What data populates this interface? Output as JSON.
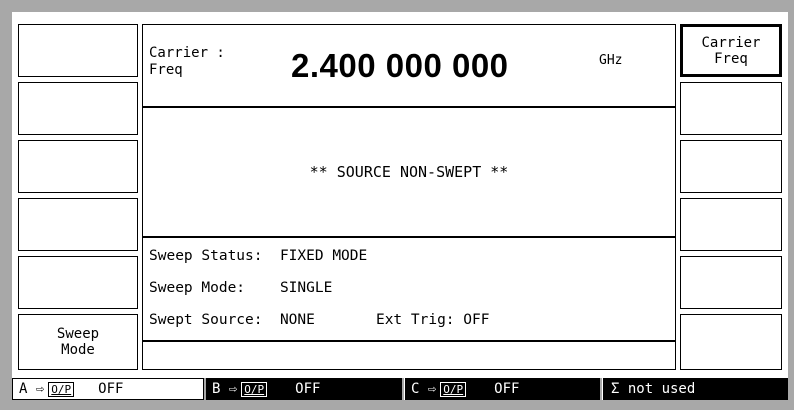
{
  "left_softkeys": [
    "",
    "",
    "",
    "",
    "",
    "Sweep\nMode"
  ],
  "right_softkeys": [
    "Carrier\nFreq",
    "",
    "",
    "",
    "",
    ""
  ],
  "header": {
    "label": "Carrier :\nFreq",
    "value": "2.400 000 000",
    "unit": "GHz"
  },
  "message": "** SOURCE NON-SWEPT **",
  "status": {
    "line1": "Sweep Status:  FIXED MODE",
    "line2": "Sweep Mode:    SINGLE",
    "line3": "Swept Source:  NONE       Ext Trig: OFF"
  },
  "bottom_bar": {
    "a_label": "A ⇨",
    "a_op": "O/P",
    "a_state": "OFF",
    "b_label": "B ⇨",
    "b_op": "O/P",
    "b_state": "OFF",
    "c_label": "C ⇨",
    "c_op": "O/P",
    "c_state": "OFF",
    "sigma_text": "Σ not used"
  }
}
